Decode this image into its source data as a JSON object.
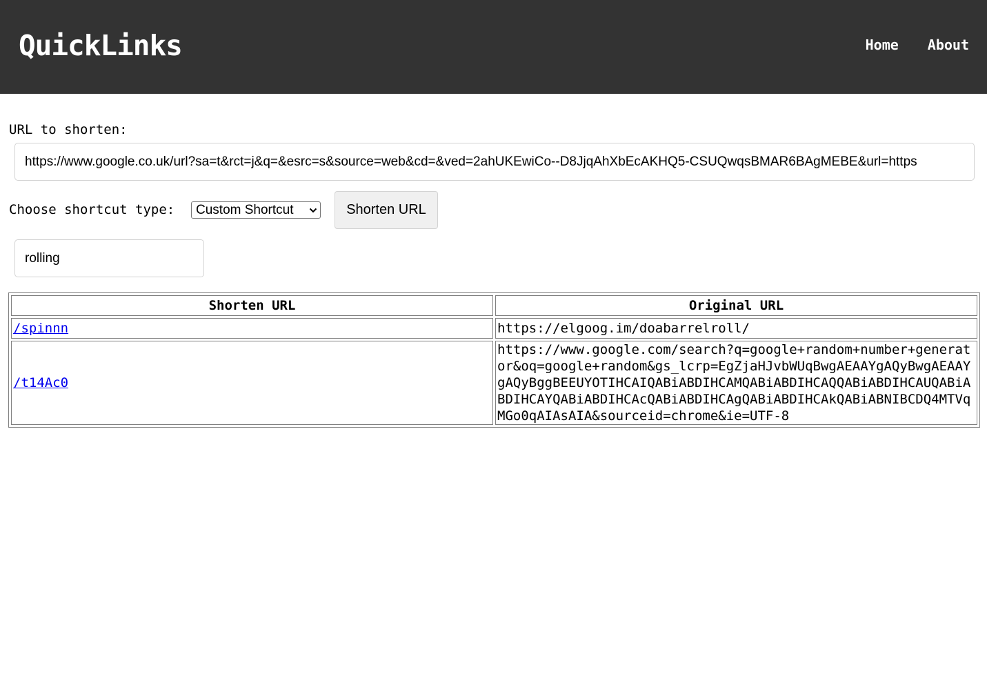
{
  "header": {
    "title": "QuickLinks",
    "nav": [
      {
        "label": "Home"
      },
      {
        "label": "About"
      }
    ]
  },
  "form": {
    "url_label": "URL to shorten:",
    "url_value": "https://www.google.co.uk/url?sa=t&rct=j&q=&esrc=s&source=web&cd=&ved=2ahUKEwiCo--D8JjqAhXbEcAKHQ5-CSUQwqsBMAR6BAgMEBE&url=https",
    "type_label": "Choose shortcut type:",
    "type_selected": "Custom Shortcut",
    "shorten_button": "Shorten URL",
    "shortcut_value": "rolling"
  },
  "table": {
    "headers": [
      "Shorten URL",
      "Original URL"
    ],
    "rows": [
      {
        "short": "/spinnn",
        "original": "https://elgoog.im/doabarrelroll/"
      },
      {
        "short": "/t14Ac0",
        "original": "https://www.google.com/search?q=google+random+number+generator&oq=google+random&gs_lcrp=EgZjaHJvbWUqBwgAEAAYgAQyBwgAEAAYgAQyBggBEEUYOTIHCAIQABiABDIHCAMQABiABDIHCAQQABiABDIHCAUQABiABDIHCAYQABiABDIHCAcQABiABDIHCAgQABiABDIHCAkQABiABNIBCDQ4MTVqMGo0qAIAsAIA&sourceid=chrome&ie=UTF-8"
      }
    ]
  }
}
